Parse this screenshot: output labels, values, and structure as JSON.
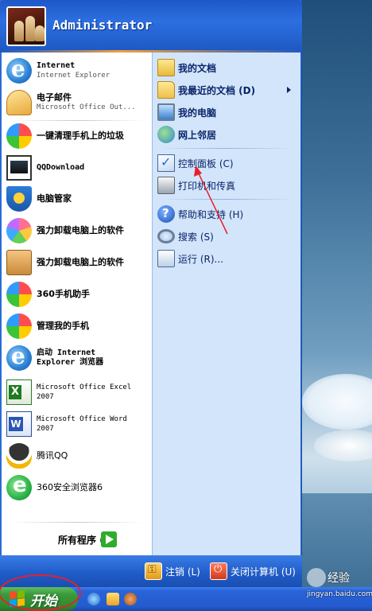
{
  "user": {
    "name": "Administrator"
  },
  "left_items": [
    {
      "name": "internet",
      "label": "Internet",
      "sub": "Internet Explorer",
      "icon": "internet-explorer-icon"
    },
    {
      "name": "email",
      "label": "电子邮件",
      "sub": "Microsoft Office Out...",
      "icon": "outlook-mail-icon"
    },
    {
      "name": "clean-phone",
      "label": "一键清理手机上的垃圾",
      "icon": "360-ball-icon"
    },
    {
      "name": "qqdownload",
      "label": "QQDownload",
      "icon": "window-app-icon"
    },
    {
      "name": "pc-manager",
      "label": "电脑管家",
      "icon": "shield-icon"
    },
    {
      "name": "uninstall-1",
      "label": "强力卸载电脑上的软件",
      "icon": "flower-icon"
    },
    {
      "name": "uninstall-2",
      "label": "强力卸载电脑上的软件",
      "icon": "box-icon"
    },
    {
      "name": "360-assistant",
      "label": "360手机助手",
      "icon": "360-ball-icon"
    },
    {
      "name": "manage-phone",
      "label": "管理我的手机",
      "icon": "360-ball-icon"
    },
    {
      "name": "launch-ie",
      "label": "启动 Internet",
      "sub": "Explorer 浏览器",
      "icon": "internet-explorer-icon"
    },
    {
      "name": "excel",
      "label": "Microsoft Office Excel",
      "sub": "2007",
      "icon": "excel-icon"
    },
    {
      "name": "word",
      "label": "Microsoft Office Word",
      "sub": "2007",
      "icon": "word-icon"
    },
    {
      "name": "qq",
      "label": "腾讯QQ",
      "icon": "qq-penguin-icon"
    },
    {
      "name": "360-browser",
      "label": "360安全浏览器6",
      "icon": "360-browser-icon"
    }
  ],
  "all_programs": "所有程序 (P)",
  "right_items": [
    {
      "name": "my-documents",
      "label": "我的文档",
      "icon": "folder-icon",
      "bold": true
    },
    {
      "name": "recent-documents",
      "label": "我最近的文档 (D)",
      "icon": "folder-icon",
      "bold": true
    },
    {
      "name": "my-computer",
      "label": "我的电脑",
      "icon": "computer-icon",
      "bold": true
    },
    {
      "name": "network-places",
      "label": "网上邻居",
      "icon": "network-icon",
      "bold": true
    },
    {
      "name": "control-panel",
      "label": "控制面板 (C)",
      "icon": "control-panel-icon",
      "bold": false
    },
    {
      "name": "printers",
      "label": "打印机和传真",
      "icon": "printer-icon",
      "bold": false
    },
    {
      "name": "help",
      "label": "帮助和支持 (H)",
      "icon": "help-icon",
      "bold": false
    },
    {
      "name": "search",
      "label": "搜索 (S)",
      "icon": "search-icon",
      "bold": false
    },
    {
      "name": "run",
      "label": "运行 (R)...",
      "icon": "run-icon",
      "bold": false
    }
  ],
  "footer": {
    "logoff": "注销 (L)",
    "shutdown": "关闭计算机 (U)"
  },
  "taskbar": {
    "start_label": "开始"
  },
  "watermark": {
    "brand": "经验",
    "url": "jingyan.baidu.com"
  },
  "colors": {
    "annotation": "#e8202a",
    "menu_blue": "#2a6bd4",
    "start_green": "#3b9a3b"
  }
}
